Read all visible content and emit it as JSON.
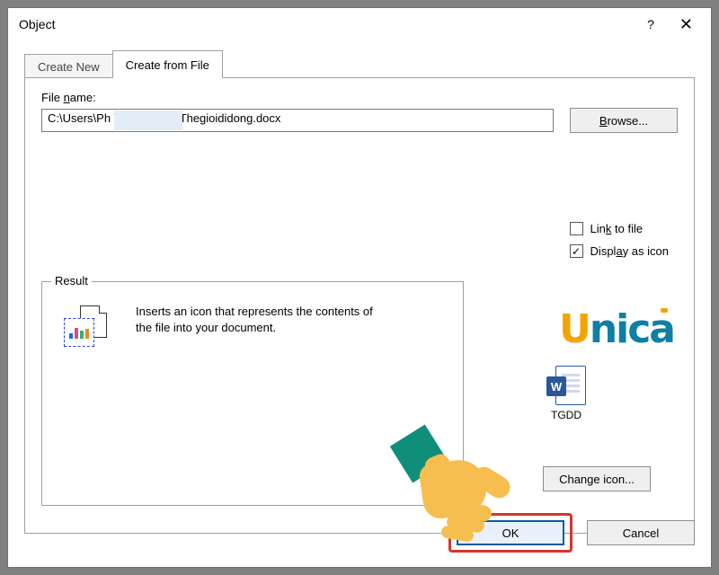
{
  "dialog": {
    "title": "Object",
    "help_char": "?",
    "close_char": "✕"
  },
  "tabs": {
    "create_new": "Create New",
    "create_from_file": "Create from File"
  },
  "file": {
    "label": "File name:",
    "path": "C:\\Users\\Ph             \\Documents\\Thegioididong.docx",
    "browse_label": "Browse..."
  },
  "checks": {
    "link_label": "Link to file",
    "display_label": "Display as icon"
  },
  "result": {
    "legend": "Result",
    "text": "Inserts an icon that represents the contents of the file into your document."
  },
  "watermark": {
    "text": "Unica"
  },
  "word_icon": {
    "letter": "W",
    "caption": "TGDD"
  },
  "change_icon": {
    "label": "Change icon..."
  },
  "buttons": {
    "ok": "OK",
    "cancel": "Cancel"
  }
}
